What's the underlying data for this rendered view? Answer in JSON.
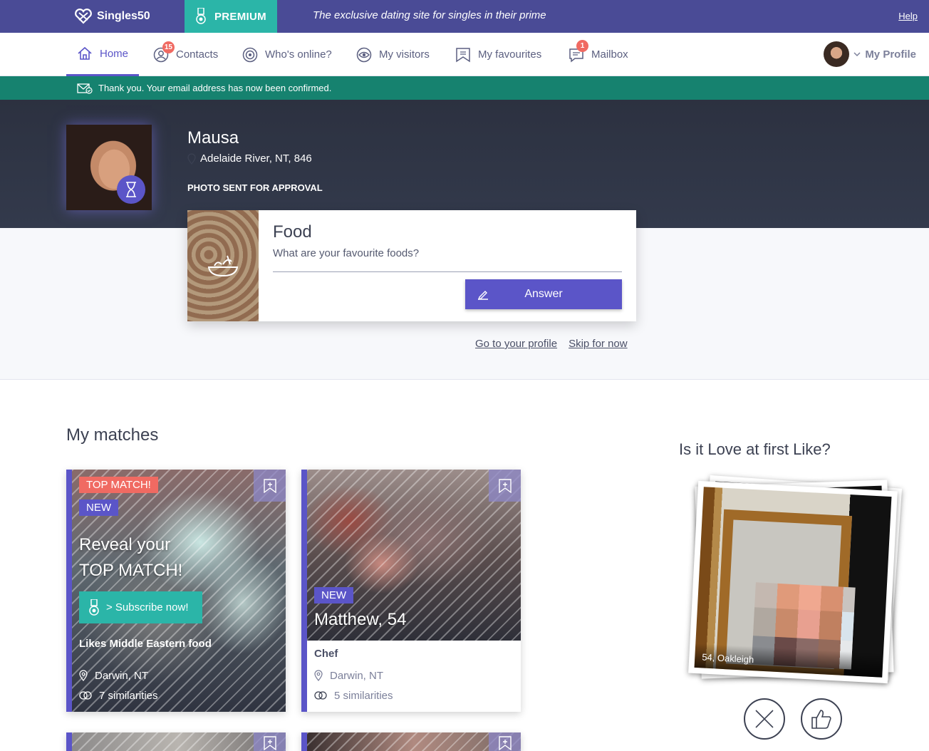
{
  "topbar": {
    "logo_text": "Singles50",
    "premium_label": "PREMIUM",
    "tagline": "The exclusive dating site for singles in their prime",
    "help_label": "Help"
  },
  "nav": {
    "home": "Home",
    "contacts": "Contacts",
    "contacts_badge": "15",
    "whos_online": "Who's online?",
    "my_visitors": "My visitors",
    "my_favourites": "My favourites",
    "mailbox": "Mailbox",
    "mailbox_badge": "1",
    "my_profile": "My Profile"
  },
  "confirm_message": "Thank you. Your email address has now been confirmed.",
  "hero": {
    "name": "Mausa",
    "location": "Adelaide River, NT, 846",
    "status": "PHOTO SENT FOR APPROVAL"
  },
  "question": {
    "title": "Food",
    "prompt": "What are your favourite foods?",
    "answer_label": "Answer",
    "go_to_profile": "Go to your profile",
    "skip": "Skip for now"
  },
  "matches": {
    "title": "My matches",
    "cards": [
      {
        "tag_top": "TOP MATCH!",
        "tag_new": "NEW",
        "reveal_line1": "Reveal your",
        "reveal_line2": "TOP MATCH!",
        "subscribe_label": "> Subscribe now!",
        "interest": "Likes Middle Eastern food",
        "location": "Darwin, NT",
        "similarities": "7 similarities"
      },
      {
        "tag_new": "NEW",
        "name": "Matthew, 54",
        "occupation": "Chef",
        "location": "Darwin, NT",
        "similarities": "5 similarities"
      }
    ]
  },
  "like_section": {
    "title": "Is it Love at first Like?",
    "photo_caption": "54, Oakleigh"
  },
  "colors": {
    "brand_purple": "#4a4b96",
    "accent_purple": "#5b55c8",
    "teal": "#2bb5a8",
    "confirm_green": "#16826f",
    "badge_red": "#f06a62"
  }
}
